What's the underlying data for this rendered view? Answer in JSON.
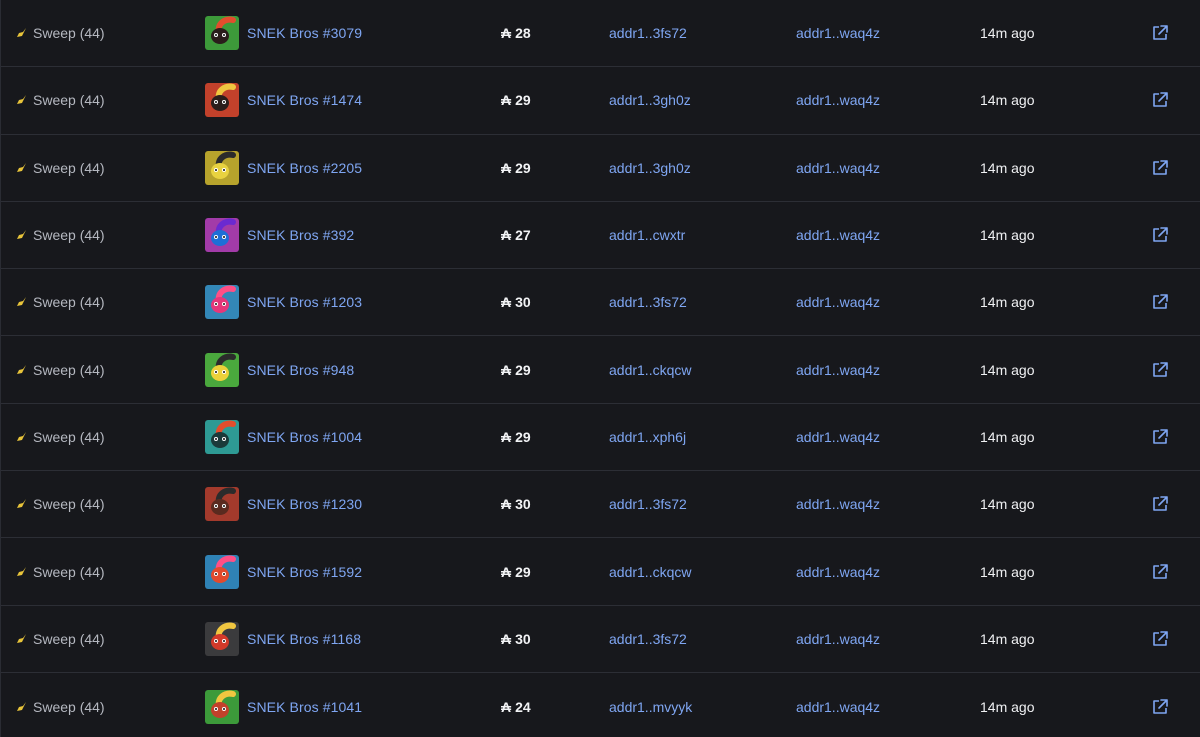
{
  "colors": {
    "background": "#17181c",
    "link": "#7fa6f2",
    "text_muted": "#b5b8c0",
    "text_strong": "#f2f3f5",
    "broom": "#e8c43a"
  },
  "icons": {
    "event": "broom-icon",
    "currency": "ada-icon",
    "action": "external-link-icon"
  },
  "currency_symbol": "₳",
  "rows": [
    {
      "event": "Sweep (44)",
      "name": "SNEK Bros #3079",
      "price": "28",
      "from": "addr1..3fs72",
      "to": "addr1..waq4z",
      "time": "14m ago",
      "thumb_bg": "#3d9a3a",
      "thumb_fg": "#2a1d1b",
      "thumb_accent": "#e34d2d"
    },
    {
      "event": "Sweep (44)",
      "name": "SNEK Bros #1474",
      "price": "29",
      "from": "addr1..3gh0z",
      "to": "addr1..waq4z",
      "time": "14m ago",
      "thumb_bg": "#c2412b",
      "thumb_fg": "#2a1d1b",
      "thumb_accent": "#f0c640"
    },
    {
      "event": "Sweep (44)",
      "name": "SNEK Bros #2205",
      "price": "29",
      "from": "addr1..3gh0z",
      "to": "addr1..waq4z",
      "time": "14m ago",
      "thumb_bg": "#b7a32c",
      "thumb_fg": "#e8d240",
      "thumb_accent": "#2b2b2b"
    },
    {
      "event": "Sweep (44)",
      "name": "SNEK Bros #392",
      "price": "27",
      "from": "addr1..cwxtr",
      "to": "addr1..waq4z",
      "time": "14m ago",
      "thumb_bg": "#a23ba8",
      "thumb_fg": "#1e6fd6",
      "thumb_accent": "#6a2ad0"
    },
    {
      "event": "Sweep (44)",
      "name": "SNEK Bros #1203",
      "price": "30",
      "from": "addr1..3fs72",
      "to": "addr1..waq4z",
      "time": "14m ago",
      "thumb_bg": "#3387b7",
      "thumb_fg": "#e6367a",
      "thumb_accent": "#ff4f86"
    },
    {
      "event": "Sweep (44)",
      "name": "SNEK Bros #948",
      "price": "29",
      "from": "addr1..ckqcw",
      "to": "addr1..waq4z",
      "time": "14m ago",
      "thumb_bg": "#4aa83d",
      "thumb_fg": "#ecd13a",
      "thumb_accent": "#2b2b2b"
    },
    {
      "event": "Sweep (44)",
      "name": "SNEK Bros #1004",
      "price": "29",
      "from": "addr1..xph6j",
      "to": "addr1..waq4z",
      "time": "14m ago",
      "thumb_bg": "#2e9a94",
      "thumb_fg": "#1b3a3a",
      "thumb_accent": "#e34d2d"
    },
    {
      "event": "Sweep (44)",
      "name": "SNEK Bros #1230",
      "price": "30",
      "from": "addr1..3fs72",
      "to": "addr1..waq4z",
      "time": "14m ago",
      "thumb_bg": "#a33a2c",
      "thumb_fg": "#5a2a1f",
      "thumb_accent": "#2b2b2b"
    },
    {
      "event": "Sweep (44)",
      "name": "SNEK Bros #1592",
      "price": "29",
      "from": "addr1..ckqcw",
      "to": "addr1..waq4z",
      "time": "14m ago",
      "thumb_bg": "#2f82b5",
      "thumb_fg": "#e24a2d",
      "thumb_accent": "#ff4f86"
    },
    {
      "event": "Sweep (44)",
      "name": "SNEK Bros #1168",
      "price": "30",
      "from": "addr1..3fs72",
      "to": "addr1..waq4z",
      "time": "14m ago",
      "thumb_bg": "#3b3b3d",
      "thumb_fg": "#d23a2a",
      "thumb_accent": "#f0c640"
    },
    {
      "event": "Sweep (44)",
      "name": "SNEK Bros #1041",
      "price": "24",
      "from": "addr1..mvyyk",
      "to": "addr1..waq4z",
      "time": "14m ago",
      "thumb_bg": "#3c9a3a",
      "thumb_fg": "#c2412b",
      "thumb_accent": "#f0c640"
    }
  ]
}
